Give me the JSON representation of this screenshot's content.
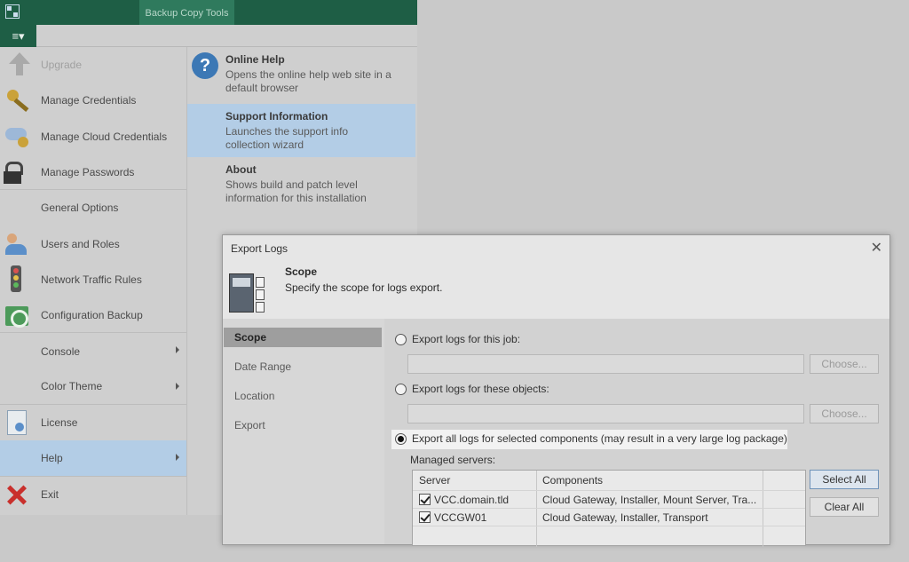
{
  "topbar": {
    "tool_tab": "Backup Copy Tools"
  },
  "menu_button": {
    "glyph": "≡▾"
  },
  "left_menu": {
    "items": [
      {
        "label": "Upgrade",
        "icon": "upgrade-arrow-icon"
      },
      {
        "label": "Manage Credentials",
        "icon": "key-icon"
      },
      {
        "label": "Manage Cloud Credentials",
        "icon": "cloud-key-icon"
      },
      {
        "label": "Manage Passwords",
        "icon": "lock-icon"
      },
      {
        "label": "General Options",
        "icon": ""
      },
      {
        "label": "Users and Roles",
        "icon": "users-icon"
      },
      {
        "label": "Network Traffic Rules",
        "icon": "traffic-light-icon"
      },
      {
        "label": "Configuration Backup",
        "icon": "config-backup-icon"
      },
      {
        "label": "Console",
        "icon": ""
      },
      {
        "label": "Color Theme",
        "icon": ""
      },
      {
        "label": "License",
        "icon": "license-icon"
      },
      {
        "label": "Help",
        "icon": ""
      },
      {
        "label": "Exit",
        "icon": "exit-icon"
      }
    ]
  },
  "help_menu": {
    "items": [
      {
        "title": "Online Help",
        "desc1": "Opens the online help web site in a",
        "desc2": "default browser"
      },
      {
        "title": "Support Information",
        "desc1": "Launches the support info",
        "desc2": "collection wizard"
      },
      {
        "title": "About",
        "desc1": "Shows build and patch level",
        "desc2": "information for this installation"
      }
    ]
  },
  "dialog": {
    "title": "Export Logs",
    "close": "✕",
    "header_title": "Scope",
    "header_subtitle": "Specify the scope for logs export.",
    "nav": [
      "Scope",
      "Date Range",
      "Location",
      "Export"
    ],
    "options": {
      "job_label": "Export logs for this job:",
      "objects_label": "Export logs for these objects:",
      "all_label": "Export all logs for selected components (may result in a very large log package)",
      "choose1": "Choose...",
      "choose2": "Choose..."
    },
    "managed_servers_label": "Managed servers:",
    "table": {
      "headers": [
        "Server",
        "Components"
      ],
      "rows": [
        {
          "server": "VCC.domain.tld",
          "components": "Cloud Gateway, Installer, Mount Server, Tra..."
        },
        {
          "server": "VCCGW01",
          "components": "Cloud Gateway, Installer, Transport"
        }
      ]
    },
    "buttons": {
      "select_all": "Select All",
      "clear_all": "Clear All"
    }
  }
}
